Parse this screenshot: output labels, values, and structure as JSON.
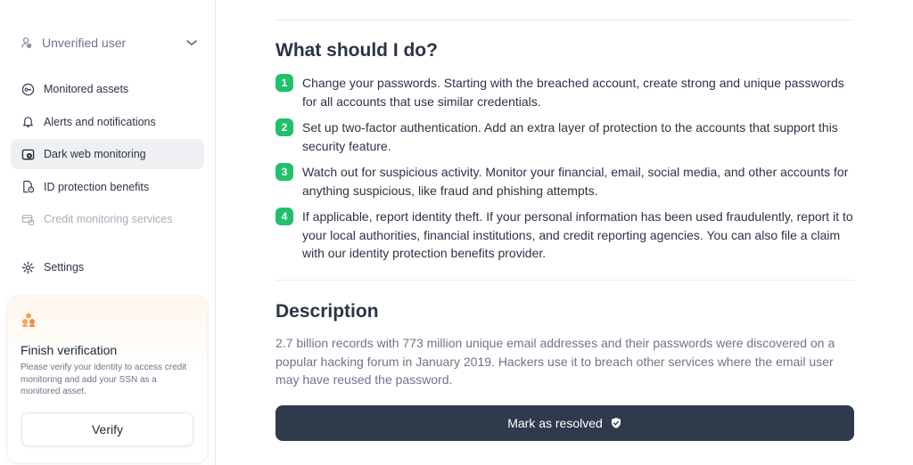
{
  "sidebar": {
    "user": {
      "label": "Unverified user",
      "icon": "user-shield-icon"
    },
    "items": [
      {
        "label": "Monitored assets",
        "icon": "key-icon",
        "active": false,
        "disabled": false
      },
      {
        "label": "Alerts and notifications",
        "icon": "bell-icon",
        "active": false,
        "disabled": false
      },
      {
        "label": "Dark web monitoring",
        "icon": "dark-web-icon",
        "active": true,
        "disabled": false
      },
      {
        "label": "ID protection benefits",
        "icon": "id-document-icon",
        "active": false,
        "disabled": false
      },
      {
        "label": "Credit monitoring services",
        "icon": "credit-card-icon",
        "active": false,
        "disabled": true
      }
    ],
    "settings": {
      "label": "Settings",
      "icon": "gear-icon"
    },
    "verify_card": {
      "icon": "users-icon",
      "title": "Finish verification",
      "description": "Please verify your identity to access credit monitoring and add your SSN as a monitored asset.",
      "button": "Verify"
    }
  },
  "main": {
    "what_heading": "What should I do?",
    "steps": [
      {
        "num": "1",
        "text": "Change your passwords. Starting with the breached account, create strong and unique passwords for all accounts that use similar credentials."
      },
      {
        "num": "2",
        "text": "Set up two-factor authentication. Add an extra layer of protection to the accounts that support this security feature."
      },
      {
        "num": "3",
        "text": "Watch out for suspicious activity. Monitor your financial, email, social media, and other accounts for anything suspicious, like fraud and phishing attempts."
      },
      {
        "num": "4",
        "text": "If applicable, report identity theft. If your personal information has been used fraudulently, report it to your local authorities, financial institutions, and credit reporting agencies. You can also file a claim with our identity protection benefits provider."
      }
    ],
    "description_heading": "Description",
    "description": "2.7 billion records with 773 million unique email addresses and their passwords were discovered on a popular hacking forum in January 2019. Hackers use it to breach other services where the email user may have reused the password.",
    "resolve_button": "Mark as resolved",
    "resolve_icon": "shield-check-icon"
  },
  "colors": {
    "accent_green": "#1fc16b",
    "primary_button": "#2f3a4c",
    "active_nav": "#eef0f4",
    "muted_text": "#6d7587"
  }
}
